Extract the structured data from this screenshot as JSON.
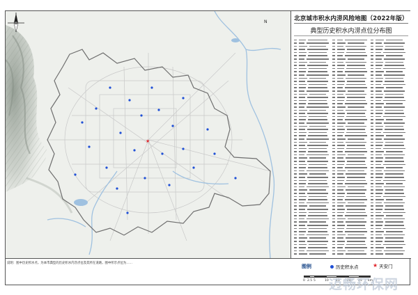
{
  "header": {
    "title": "北京城市积水内涝风险地图（2022年版）",
    "subtitle": "典型历史积水内涝点位分布图"
  },
  "map": {
    "north_label": "N",
    "colors": {
      "background": "#eef0ec",
      "water": "#9fc1e0",
      "boundary": "#6e6e6e",
      "road": "#c8c8c8",
      "relief": "#9aa39a",
      "flood_point": "#1f4fd6",
      "tiananmen": "#e0262c"
    }
  },
  "legend": {
    "heading": "图例",
    "items": [
      {
        "label": "历史积水点",
        "icon": "blue-dot-icon",
        "color": "#1f4fd6"
      },
      {
        "label": "天安门",
        "icon": "red-star-icon",
        "color": "#e0262c"
      }
    ]
  },
  "scale": {
    "labels": [
      "0",
      "2.5",
      "5",
      "10",
      "15",
      "20",
      "25"
    ],
    "unit": "km"
  },
  "note": {
    "text": "说明：图中历史积水点，为本市典型的历史积水内涝点位及其所在道路，图中所示点位为……"
  },
  "watermark": "迈畅环保网"
}
